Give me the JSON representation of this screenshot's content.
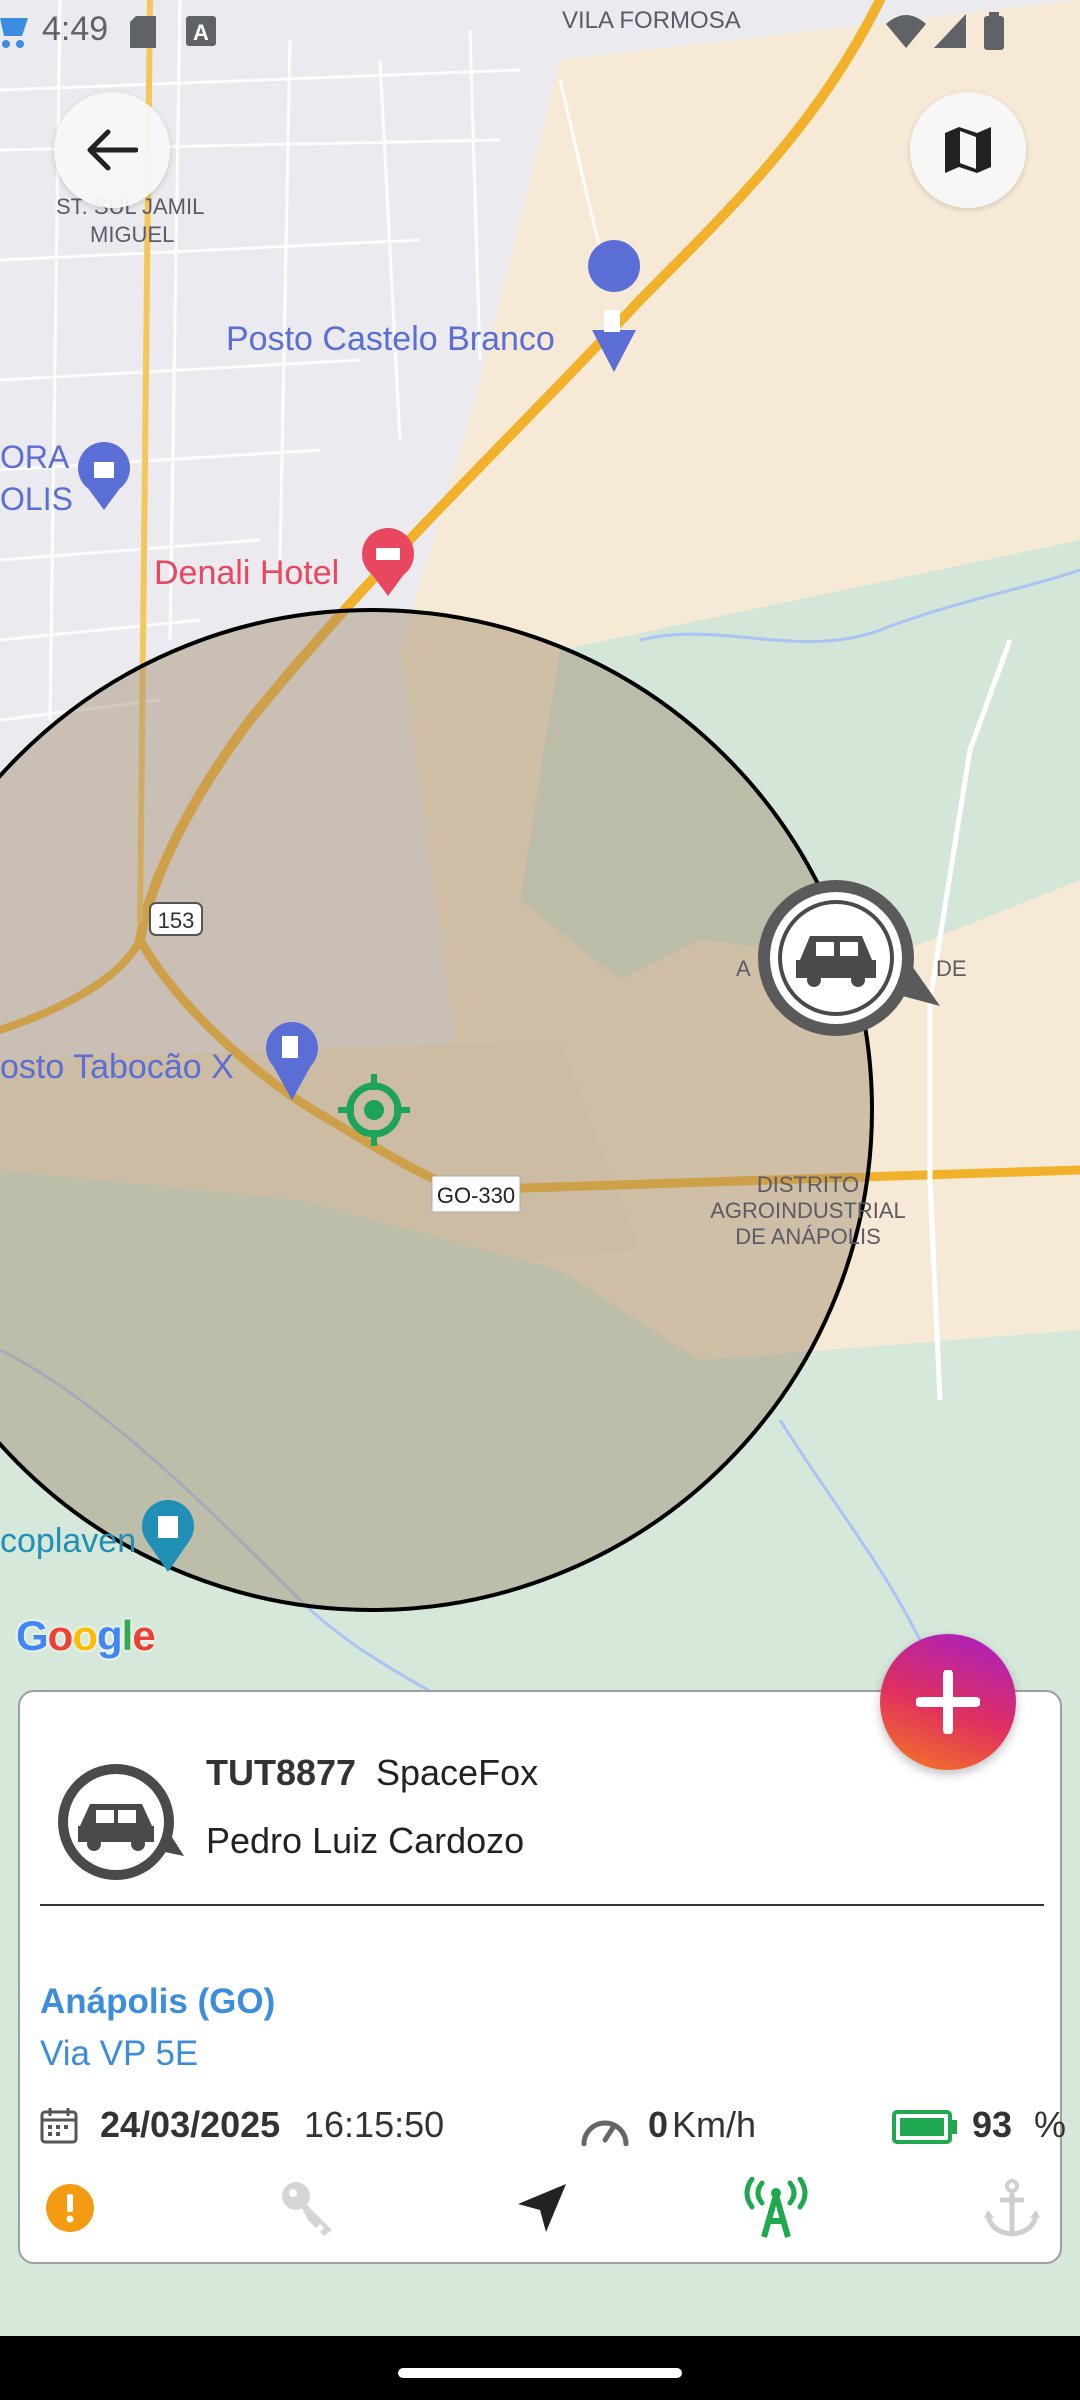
{
  "status_bar": {
    "time": "4:49",
    "icons": [
      "cart-icon",
      "sd-card-icon",
      "font-a-icon",
      "wifi-icon",
      "signal-icon",
      "battery-icon"
    ]
  },
  "map": {
    "labels": {
      "vila_formosa": "VILA FORMOSA",
      "st_sul_jamil_1": "ST. SUL JAMIL",
      "st_sul_jamil_2": "MIGUEL",
      "posto_castelo": "Posto Castelo Branco",
      "ora": "ORA",
      "olis": "OLIS",
      "denali": "Denali Hotel",
      "road_153": "153",
      "posto_tabocao": "osto Tabocão X",
      "go330": "GO-330",
      "distrito_1": "DISTRITO",
      "distrito_2": "AGROINDUSTRIAL",
      "distrito_3": "DE ANÁPOLIS",
      "ac_1": "A",
      "ac_1b": "DE",
      "coplaven": "coplaven"
    },
    "google_logo": [
      "G",
      "o",
      "o",
      "g",
      "l",
      "e"
    ],
    "colors": {
      "road": "#f2b12a",
      "geofence_fill": "#a08c6e",
      "geofence_stroke": "#000000",
      "poi_blue": "#5a6ed6",
      "poi_red": "#e8475f",
      "target": "#1ea35a"
    }
  },
  "vehicle": {
    "plate": "TUT8877",
    "model": "SpaceFox",
    "driver": "Pedro Luiz Cardozo",
    "city": "Anápolis (GO)",
    "street": "Via VP 5E",
    "date": "24/03/2025",
    "time": "16:15:50",
    "speed": "0",
    "speed_unit": "Km/h",
    "battery": "93",
    "battery_unit": "%"
  },
  "actions": [
    "alert-icon",
    "key-icon",
    "navigation-icon",
    "signal-tower-icon",
    "anchor-icon"
  ],
  "accent": {
    "link_blue": "#3c8ddb",
    "alert_orange": "#f39c12",
    "battery_green": "#1fa84f"
  }
}
